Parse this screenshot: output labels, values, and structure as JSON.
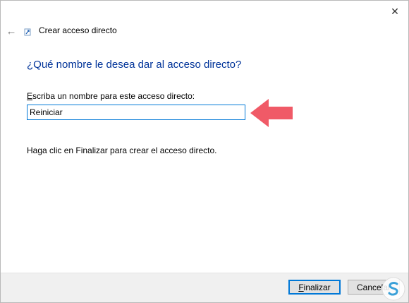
{
  "window": {
    "close_glyph": "✕"
  },
  "nav": {
    "back_glyph": "←",
    "title": "Crear acceso directo"
  },
  "main": {
    "heading": "¿Qué nombre le desea dar al acceso directo?",
    "field_label_accel": "E",
    "field_label_rest": "scriba un nombre para este acceso directo:",
    "name_value": "Reiniciar",
    "info_text": "Haga clic en Finalizar para crear el acceso directo."
  },
  "footer": {
    "finish_accel": "F",
    "finish_rest": "inalizar",
    "cancel_label": "Cancelar"
  },
  "icons": {
    "close": "close-icon",
    "back": "back-arrow-icon",
    "wizard": "shortcut-wizard-icon",
    "pointer": "red-arrow-pointer-icon",
    "watermark": "solvetic-logo-icon"
  },
  "colors": {
    "heading": "#003399",
    "input_border": "#0078d7",
    "arrow": "#f05a67",
    "footer_bg": "#f0f0f0"
  }
}
